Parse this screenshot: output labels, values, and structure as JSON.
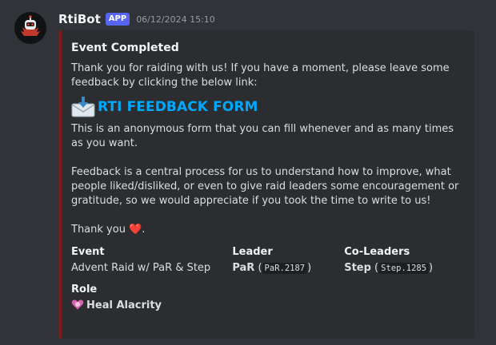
{
  "message": {
    "username": "RtiBot",
    "badge": "APP",
    "timestamp": "06/12/2024 15:10"
  },
  "embed": {
    "title": "Event Completed",
    "intro": "Thank you for raiding with us! If you have a moment, please leave some feedback by clicking the below link:",
    "link_icon": "envelope-with-arrow-icon",
    "link_text": "RTI FEEDBACK FORM",
    "para2": "This is an anonymous form that you can fill whenever and as many times as you want.",
    "para3": "Feedback is a central process for us to understand how to improve, what people liked/disliked, or even to give raid leaders some encouragement or gratitude, so we would appreciate if you took the time to write to us!",
    "thanks": "Thank you",
    "thanks_icon": "red-heart-icon",
    "thanks_tail": ".",
    "fields": {
      "event": {
        "name": "Event",
        "value": "Advent Raid w/ PaR & Step"
      },
      "leader": {
        "name": "Leader",
        "value_bold": "PaR",
        "value_code": "PaR.2187"
      },
      "coleaders": {
        "name": "Co-Leaders",
        "value_bold": "Step",
        "value_code": "Step.1285"
      },
      "role": {
        "name": "Role",
        "value": "Heal Alacrity",
        "icon": "alacrity-heart-icon"
      }
    },
    "accent_color": "#7d1a1a",
    "link_color": "#00a8fc"
  }
}
